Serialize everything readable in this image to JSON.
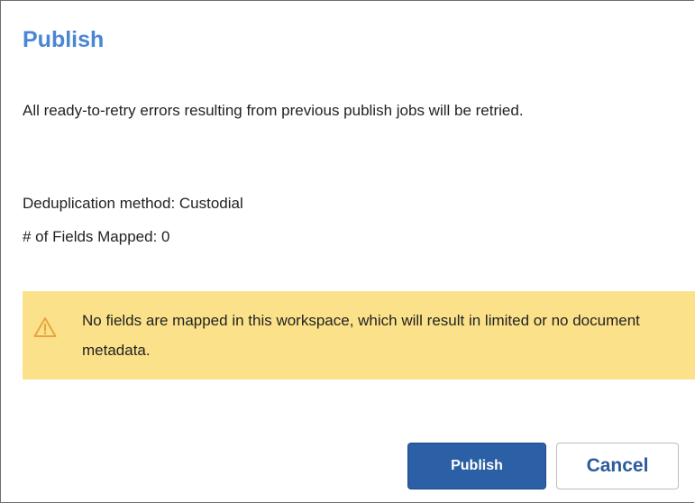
{
  "dialog": {
    "title": "Publish",
    "message": "All ready-to-retry errors resulting from previous publish jobs will be retried.",
    "dedup_line": "Deduplication method: Custodial",
    "fields_line": "# of Fields Mapped: 0"
  },
  "warning": {
    "icon": "warning-triangle-icon",
    "text": "No fields are mapped in this workspace, which will result in limited or no document metadata.",
    "background": "#fbe28a",
    "icon_color": "#e8a33d"
  },
  "buttons": {
    "publish_label": "Publish",
    "cancel_label": "Cancel"
  },
  "colors": {
    "title": "#4a86d4",
    "primary_button": "#2b5fa6",
    "secondary_button_text": "#2d5b9a"
  }
}
